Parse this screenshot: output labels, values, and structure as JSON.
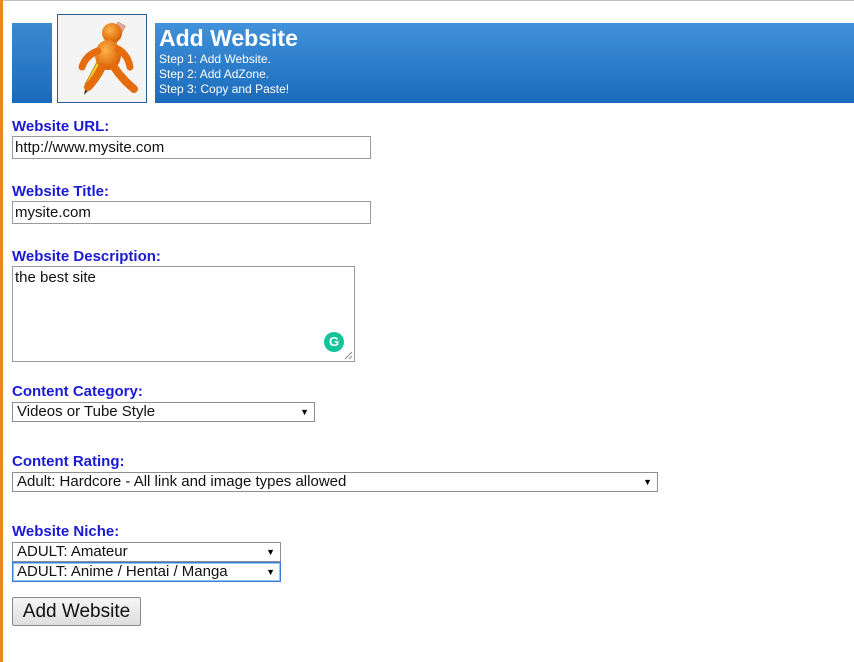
{
  "header": {
    "title": "Add Website",
    "steps": [
      "Step 1: Add Website.",
      "Step 2: Add AdZone.",
      "Step 3: Copy and Paste!"
    ]
  },
  "form": {
    "url": {
      "label": "Website URL:",
      "value": "http://www.mysite.com"
    },
    "title": {
      "label": "Website Title:",
      "value": "mysite.com"
    },
    "description": {
      "label": "Website Description:",
      "value": "the best site"
    },
    "category": {
      "label": "Content Category:",
      "selected": "Videos or Tube Style"
    },
    "rating": {
      "label": "Content Rating:",
      "selected": "Adult: Hardcore - All link and image types allowed"
    },
    "niche": {
      "label": "Website Niche:",
      "selected_1": "ADULT: Amateur",
      "selected_2": "ADULT: Anime / Hentai / Manga"
    },
    "submit_label": "Add Website"
  },
  "icons": {
    "logo": "orange-figure-with-pencil-icon",
    "grammarly": "grammarly-g-icon",
    "dropdown": "chevron-down-icon",
    "resize": "resize-grip-icon"
  },
  "colors": {
    "header_blue": "#1a6bbb",
    "label_blue": "#1a1ad4",
    "left_accent": "#e88a1a",
    "grammarly_green": "#15c39a"
  }
}
